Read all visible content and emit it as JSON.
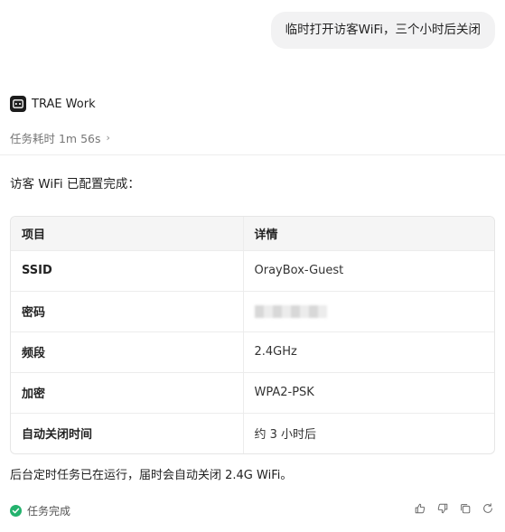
{
  "user_message": "临时打开访客WiFi，三个小时后关闭",
  "agent": {
    "name": "TRAE Work",
    "elapsed_label": "任务耗时 1m 56s",
    "logo_icon": "terminal-icon"
  },
  "intro_text": "访客 WiFi 已配置完成：",
  "table": {
    "headers": [
      "项目",
      "详情"
    ],
    "rows": [
      {
        "key": "SSID",
        "value": "OrayBox-Guest"
      },
      {
        "key": "密码",
        "value": ""
      },
      {
        "key": "频段",
        "value": "2.4GHz"
      },
      {
        "key": "加密",
        "value": "WPA2-PSK"
      },
      {
        "key": "自动关闭时间",
        "value": "约 3 小时后"
      }
    ]
  },
  "footer_text": "后台定时任务已在运行，届时会自动关闭 2.4G WiFi。",
  "status_text": "任务完成",
  "colors": {
    "success": "#23b26d",
    "bubble_bg": "#f2f2f3",
    "table_header_bg": "#f5f5f5"
  },
  "action_icons": [
    "thumbs-up-icon",
    "thumbs-down-icon",
    "copy-icon",
    "refresh-icon"
  ]
}
